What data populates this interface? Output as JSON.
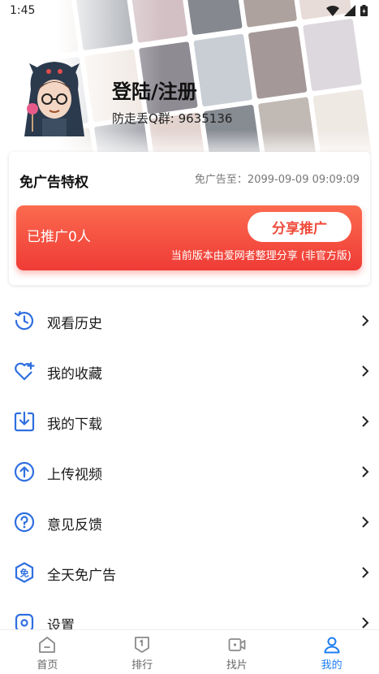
{
  "status": {
    "time": "1:45"
  },
  "profile": {
    "login_label": "登陆/注册",
    "qq_group": "防走丢Q群: 9635136"
  },
  "ad_card": {
    "title": "免广告特权",
    "expire": "免广告至：2099-09-09 09:09:09",
    "promo_count": "已推广0人",
    "share_button": "分享推广",
    "note": "当前版本由爱网者整理分享 (非官方版)"
  },
  "menu": [
    {
      "label": "观看历史",
      "icon": "history-icon"
    },
    {
      "label": "我的收藏",
      "icon": "heart-plus-icon"
    },
    {
      "label": "我的下载",
      "icon": "download-icon"
    },
    {
      "label": "上传视频",
      "icon": "upload-icon"
    },
    {
      "label": "意见反馈",
      "icon": "question-icon"
    },
    {
      "label": "全天免广告",
      "icon": "no-ad-badge-icon"
    },
    {
      "label": "设置",
      "icon": "settings-icon"
    }
  ],
  "bottom_nav": [
    {
      "label": "首页",
      "icon": "home-icon",
      "active": false
    },
    {
      "label": "排行",
      "icon": "ranking-icon",
      "active": false
    },
    {
      "label": "找片",
      "icon": "video-search-icon",
      "active": false
    },
    {
      "label": "我的",
      "icon": "user-icon",
      "active": true
    }
  ],
  "colors": {
    "accent_blue": "#1f7ef2",
    "promo_red": "#ef3b36",
    "icon_blue": "#2f6fe0"
  }
}
